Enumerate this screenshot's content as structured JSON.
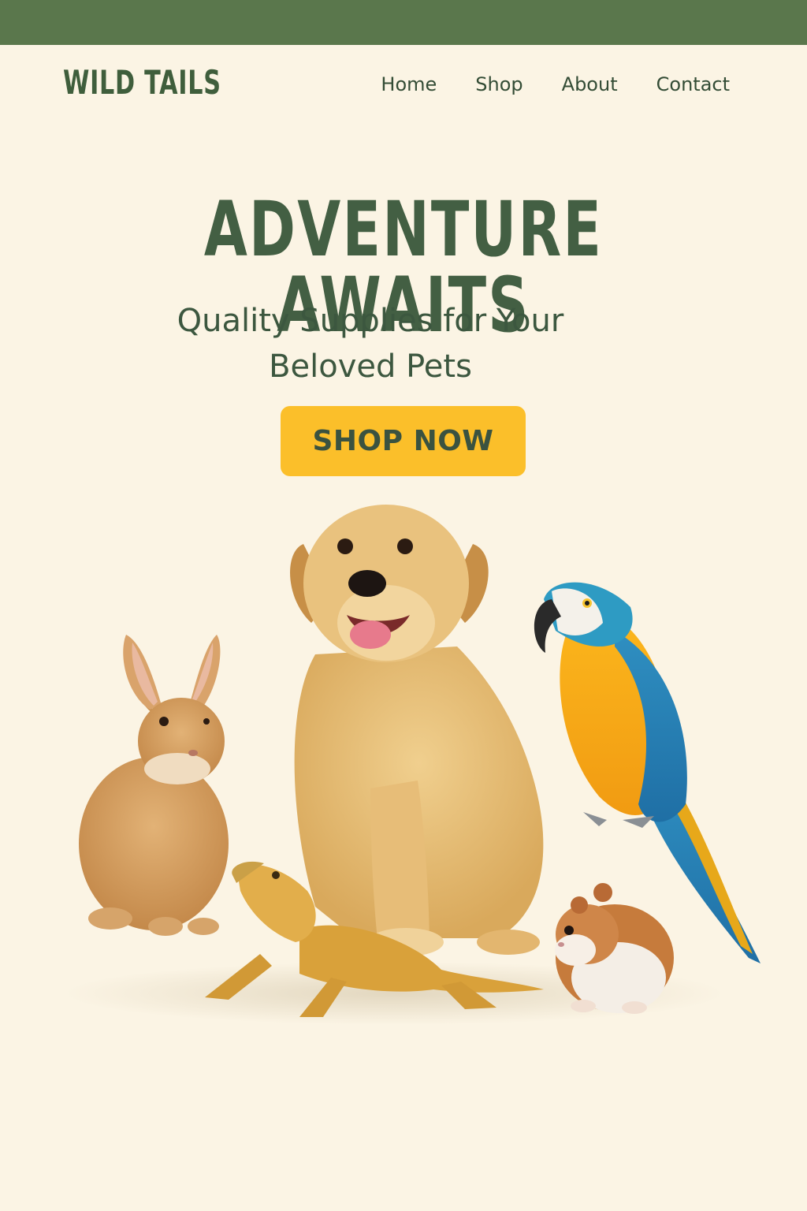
{
  "brand": {
    "name": "WILD TAILS"
  },
  "nav": {
    "items": [
      {
        "label": "Home"
      },
      {
        "label": "Shop"
      },
      {
        "label": "About"
      },
      {
        "label": "Contact"
      }
    ]
  },
  "hero": {
    "title": "ADVENTURE AWAITS",
    "subtitle": "Quality Supplies for Your Beloved Pets",
    "cta_label": "SHOP NOW"
  },
  "colors": {
    "topbar": "#5a774c",
    "background": "#fbf4e4",
    "accent": "#fbbf2a",
    "text": "#435f43"
  },
  "image": {
    "animals": [
      "rabbit",
      "dog",
      "macaw",
      "bearded-dragon",
      "hamster"
    ]
  }
}
